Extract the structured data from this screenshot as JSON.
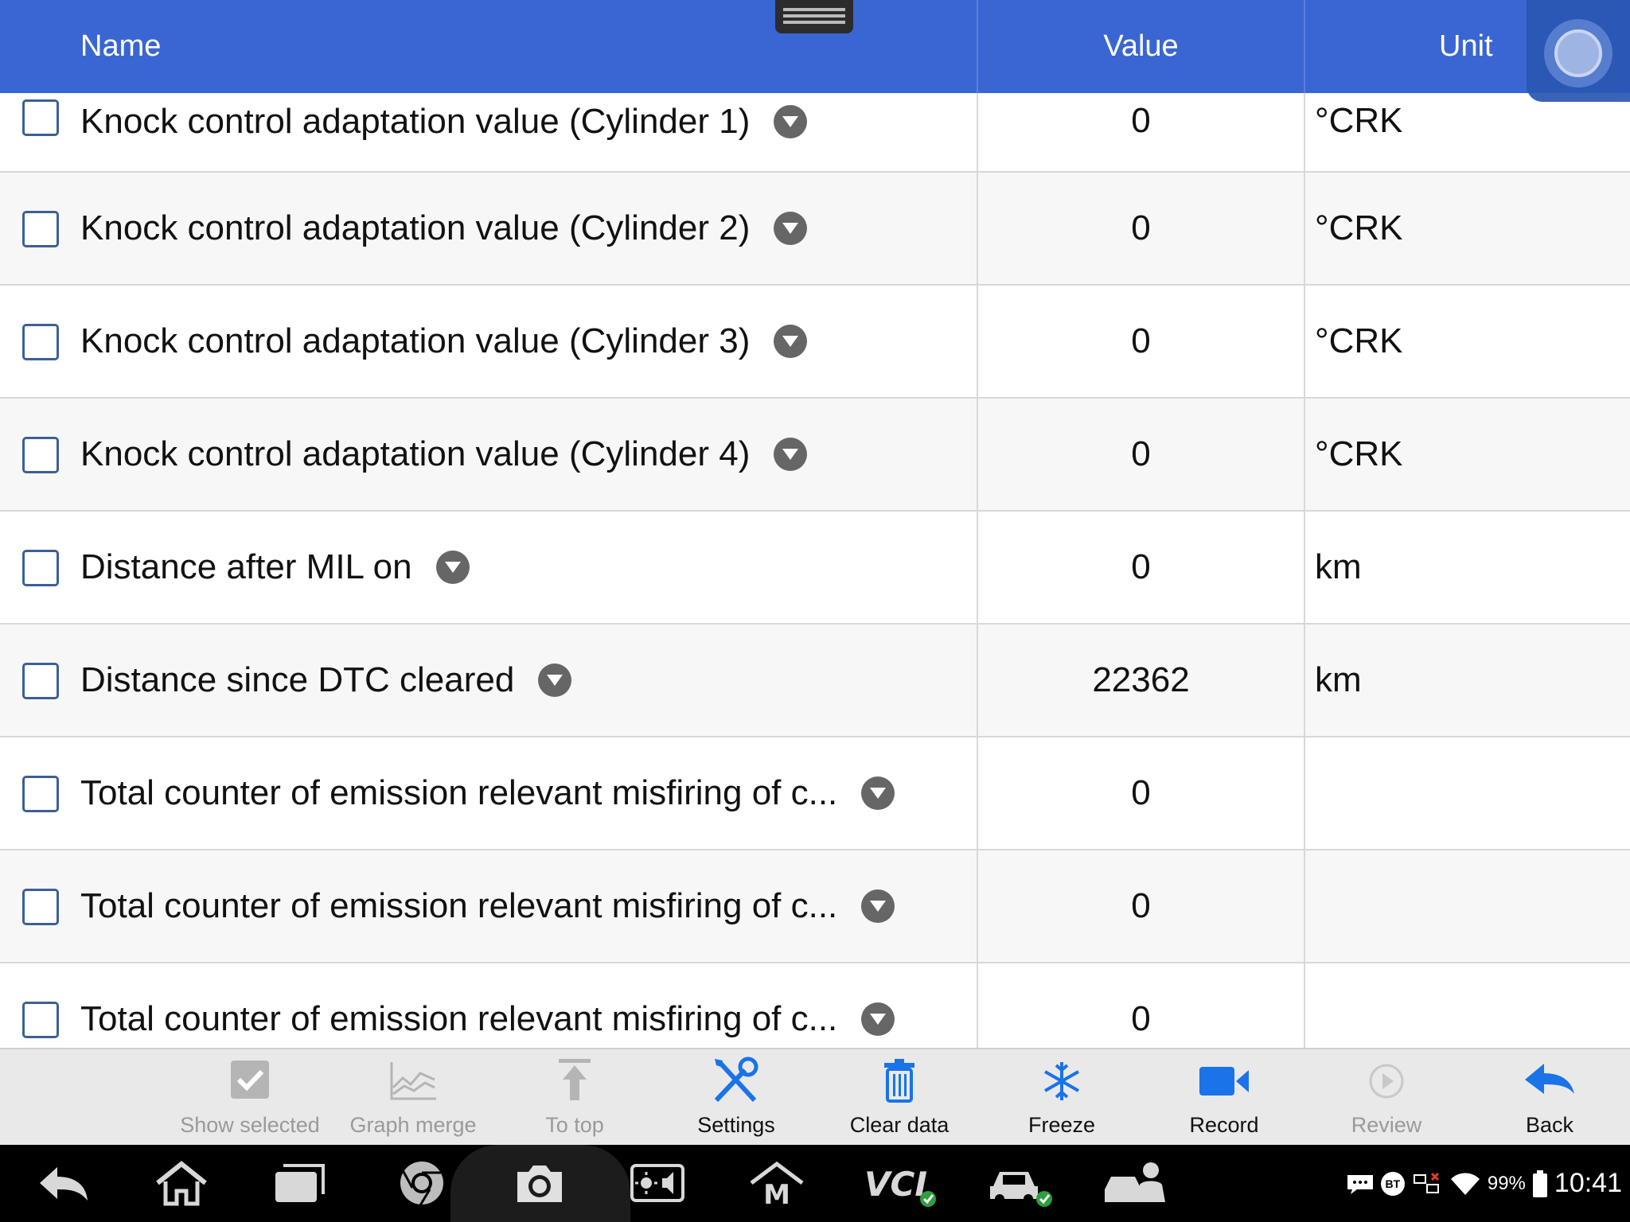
{
  "header": {
    "name_label": "Name",
    "value_label": "Value",
    "unit_label": "Unit"
  },
  "rows": [
    {
      "name": "Knock control adaptation value (Cylinder 1)",
      "value": "0",
      "unit": "°CRK",
      "checked": false
    },
    {
      "name": "Knock control adaptation value (Cylinder 2)",
      "value": "0",
      "unit": "°CRK",
      "checked": false
    },
    {
      "name": "Knock control adaptation value (Cylinder 3)",
      "value": "0",
      "unit": "°CRK",
      "checked": false
    },
    {
      "name": "Knock control adaptation value (Cylinder 4)",
      "value": "0",
      "unit": "°CRK",
      "checked": false
    },
    {
      "name": "Distance after MIL on",
      "value": "0",
      "unit": "km",
      "checked": false
    },
    {
      "name": "Distance since DTC cleared",
      "value": "22362",
      "unit": "km",
      "checked": false
    },
    {
      "name": "Total counter of emission relevant misfiring of c...",
      "value": "0",
      "unit": "",
      "checked": false
    },
    {
      "name": "Total counter of emission relevant misfiring of c...",
      "value": "0",
      "unit": "",
      "checked": false
    },
    {
      "name": "Total counter of emission relevant misfiring of c...",
      "value": "0",
      "unit": "",
      "checked": false
    }
  ],
  "toolbar": {
    "show_selected": "Show selected",
    "graph_merge": "Graph merge",
    "to_top": "To top",
    "settings": "Settings",
    "clear_data": "Clear data",
    "freeze": "Freeze",
    "record": "Record",
    "review": "Review",
    "back": "Back"
  },
  "status": {
    "bt": "BT",
    "battery": "99%",
    "time": "10:41"
  },
  "colors": {
    "header_bg": "#3a66d3",
    "accent_blue": "#1a73e8",
    "toolbar_bg": "#e9e9e9"
  }
}
